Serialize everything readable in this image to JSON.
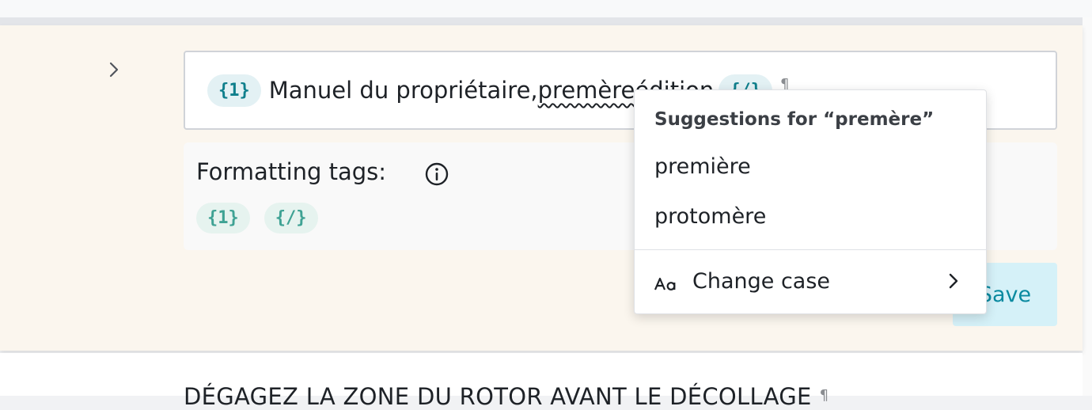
{
  "segment": {
    "open_tag": "{1}",
    "text_before": "Manuel du propriétaire, ",
    "misspelled_word": "premère",
    "text_after": " édition",
    "close_tag": "{/}",
    "pilcrow": "¶"
  },
  "formatting_tags": {
    "label": "Formatting tags:",
    "tags": [
      "{1}",
      "{/}"
    ]
  },
  "save_label": "Save",
  "next_segment": {
    "text": "DÉGAGEZ LA ZONE DU ROTOR AVANT LE DÉCOLLAGE",
    "pilcrow": "¶"
  },
  "context_menu": {
    "heading": "Suggestions for “premère”",
    "suggestions": [
      "première",
      "protomère"
    ],
    "change_case_label": "Change case"
  },
  "colors": {
    "panel_bg": "#fbf6ee",
    "tag_text": "#0f7f8c",
    "save_bg": "#d5f1f8"
  },
  "icons": {
    "expand": "chevron-right-icon",
    "info": "info-circle-icon",
    "case": "change-case-icon",
    "submenu": "chevron-right-icon"
  }
}
